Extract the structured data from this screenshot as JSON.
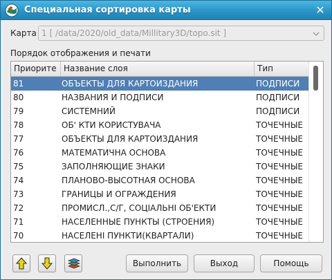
{
  "window": {
    "title": "Специальная сортировка карты",
    "close_glyph": "✕"
  },
  "map": {
    "label": "Карта",
    "value": "1 [ /data/2020/old_data/Millitary3D/topo.sit ]"
  },
  "order_label": "Порядок отображения и печати",
  "table": {
    "columns": [
      "Приорите",
      "Название слоя",
      "Тип"
    ],
    "selected_index": 0,
    "rows": [
      {
        "priority": "81",
        "name": "ОБЪЕКТЫ ДЛЯ КАРТОИЗДАНИЯ",
        "type": "ПОДПИСИ"
      },
      {
        "priority": "80",
        "name": "НАЗВАНИЯ И ПОДПИСИ",
        "type": "ПОДПИСИ"
      },
      {
        "priority": "79",
        "name": "СИСТЕМНИЙ",
        "type": "ПОДПИСИ"
      },
      {
        "priority": "78",
        "name": "ОБ' КТИ КОРИСТУВАЧА",
        "type": "ТОЧЕЧНЫЕ"
      },
      {
        "priority": "77",
        "name": "ОБЪЕКТЫ ДЛЯ КАРТОИЗДАНИЯ",
        "type": "ТОЧЕЧНЫЕ"
      },
      {
        "priority": "76",
        "name": "МАТЕМАТИЧНА ОСНОВА",
        "type": "ТОЧЕЧНЫЕ"
      },
      {
        "priority": "75",
        "name": "ЗАПОЛНЯЮЩИЕ ЗНАКИ",
        "type": "ТОЧЕЧНЫЕ"
      },
      {
        "priority": "74",
        "name": "ПЛАНОВО-ВЫСОТНАЯ ОСНОВА",
        "type": "ТОЧЕЧНЫЕ"
      },
      {
        "priority": "73",
        "name": "ГРАНИЦЫ И ОГРАЖДЕНИЯ",
        "type": "ТОЧЕЧНЫЕ"
      },
      {
        "priority": "72",
        "name": "ПРОМИСЛ.,С/Г, СОЦIАЛЬНI ОБ'ЕКТИ",
        "type": "ТОЧЕЧНЫЕ"
      },
      {
        "priority": "71",
        "name": "НАСЕЛЕННЫЕ ПУНКТЫ (СТРОЕНИЯ)",
        "type": "ТОЧЕЧНЫЕ"
      },
      {
        "priority": "70",
        "name": "НАСЕЛЕНI ПУНКТИ(КВАРТАЛИ)",
        "type": "ТОЧЕЧНЫЕ"
      }
    ]
  },
  "toolbar": {
    "up_icon": "arrow-up-icon",
    "down_icon": "arrow-down-icon",
    "layers_icon": "layers-icon"
  },
  "buttons": {
    "run": "Выполнить",
    "exit": "Выход",
    "help": "Помощь"
  },
  "colors": {
    "titlebar": "#2a95c8",
    "selection": "#4f7fb4",
    "arrow": "#e7d31a"
  }
}
